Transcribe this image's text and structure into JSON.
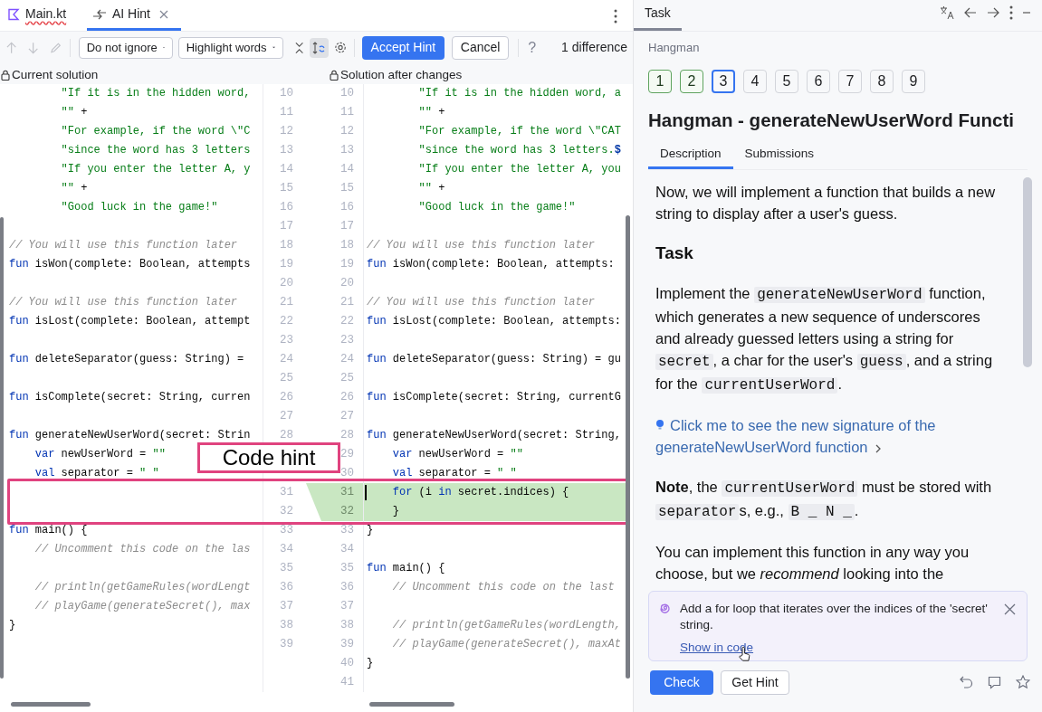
{
  "editor_tabs": [
    {
      "label": "Main.kt",
      "kind": "file",
      "selected": false,
      "has_error": true
    },
    {
      "label": "AI Hint",
      "kind": "diff",
      "selected": true,
      "closable": true
    }
  ],
  "toolbar": {
    "ignore_dropdown": "Do not ignore",
    "highlight_dropdown": "Highlight words",
    "sync_scroll_on": true,
    "accept_button": "Accept Hint",
    "cancel_button": "Cancel",
    "help": "?",
    "difference_count": "1 difference"
  },
  "diff": {
    "left_title": "Current solution",
    "right_title": "Solution after changes",
    "rows": [
      {
        "ln": "10",
        "l": [
          {
            "kind": "string",
            "text": "        \"If it is in the hidden word,"
          }
        ],
        "rn": "10",
        "r": [
          {
            "kind": "string",
            "text": "        \"If it is in the hidden word, a"
          }
        ],
        "changed": false
      },
      {
        "ln": "11",
        "l": [
          {
            "kind": "string",
            "text": "        \"\""
          },
          {
            "kind": "plain",
            "text": " +"
          }
        ],
        "rn": "11",
        "r": [
          {
            "kind": "string",
            "text": "        \"\""
          },
          {
            "kind": "plain",
            "text": " +"
          }
        ],
        "changed": false
      },
      {
        "ln": "12",
        "l": [
          {
            "kind": "string",
            "text": "        \"For example, if the word \\\"C"
          }
        ],
        "rn": "12",
        "r": [
          {
            "kind": "string",
            "text": "        \"For example, if the word \\\"CAT"
          }
        ],
        "changed": false
      },
      {
        "ln": "13",
        "l": [
          {
            "kind": "string",
            "text": "        \"since the word has 3 letters"
          }
        ],
        "rn": "13",
        "r": [
          {
            "kind": "string",
            "text": "        \"since the word has 3 letters."
          },
          {
            "kind": "template",
            "text": "$"
          }
        ],
        "changed": false
      },
      {
        "ln": "14",
        "l": [
          {
            "kind": "string",
            "text": "        \"If you enter the letter A, y"
          }
        ],
        "rn": "14",
        "r": [
          {
            "kind": "string",
            "text": "        \"If you enter the letter A, you"
          }
        ],
        "changed": false
      },
      {
        "ln": "15",
        "l": [
          {
            "kind": "string",
            "text": "        \"\""
          },
          {
            "kind": "plain",
            "text": " +"
          }
        ],
        "rn": "15",
        "r": [
          {
            "kind": "string",
            "text": "        \"\""
          },
          {
            "kind": "plain",
            "text": " +"
          }
        ],
        "changed": false
      },
      {
        "ln": "16",
        "l": [
          {
            "kind": "string",
            "text": "        \"Good luck in the game!\""
          }
        ],
        "rn": "16",
        "r": [
          {
            "kind": "string",
            "text": "        \"Good luck in the game!\""
          }
        ],
        "changed": false
      },
      {
        "ln": "17",
        "l": [],
        "rn": "17",
        "r": [],
        "changed": false
      },
      {
        "ln": "18",
        "l": [
          {
            "kind": "comment",
            "text": "// You will use this function later"
          }
        ],
        "rn": "18",
        "r": [
          {
            "kind": "comment",
            "text": "// You will use this function later"
          }
        ],
        "changed": false
      },
      {
        "ln": "19",
        "l": [
          {
            "kind": "keyword",
            "text": "fun"
          },
          {
            "kind": "plain",
            "text": " isWon(complete: Boolean, attempts"
          }
        ],
        "rn": "19",
        "r": [
          {
            "kind": "keyword",
            "text": "fun"
          },
          {
            "kind": "plain",
            "text": " isWon(complete: Boolean, attempts:"
          }
        ],
        "changed": false
      },
      {
        "ln": "20",
        "l": [],
        "rn": "20",
        "r": [],
        "changed": false
      },
      {
        "ln": "21",
        "l": [
          {
            "kind": "comment",
            "text": "// You will use this function later"
          }
        ],
        "rn": "21",
        "r": [
          {
            "kind": "comment",
            "text": "// You will use this function later"
          }
        ],
        "changed": false
      },
      {
        "ln": "22",
        "l": [
          {
            "kind": "keyword",
            "text": "fun"
          },
          {
            "kind": "plain",
            "text": " isLost(complete: Boolean, attempt"
          }
        ],
        "rn": "22",
        "r": [
          {
            "kind": "keyword",
            "text": "fun"
          },
          {
            "kind": "plain",
            "text": " isLost(complete: Boolean, attempts:"
          }
        ],
        "changed": false
      },
      {
        "ln": "23",
        "l": [],
        "rn": "23",
        "r": [],
        "changed": false
      },
      {
        "ln": "24",
        "l": [
          {
            "kind": "keyword",
            "text": "fun"
          },
          {
            "kind": "plain",
            "text": " deleteSeparator(guess: String) ="
          }
        ],
        "rn": "24",
        "r": [
          {
            "kind": "keyword",
            "text": "fun"
          },
          {
            "kind": "plain",
            "text": " deleteSeparator(guess: String) = gu"
          }
        ],
        "changed": false
      },
      {
        "ln": "25",
        "l": [],
        "rn": "25",
        "r": [],
        "changed": false
      },
      {
        "ln": "26",
        "l": [
          {
            "kind": "keyword",
            "text": "fun"
          },
          {
            "kind": "plain",
            "text": " isComplete(secret: String, curren"
          }
        ],
        "rn": "26",
        "r": [
          {
            "kind": "keyword",
            "text": "fun"
          },
          {
            "kind": "plain",
            "text": " isComplete(secret: String, currentG"
          }
        ],
        "changed": false
      },
      {
        "ln": "27",
        "l": [],
        "rn": "27",
        "r": [],
        "changed": false
      },
      {
        "ln": "28",
        "l": [
          {
            "kind": "keyword",
            "text": "fun"
          },
          {
            "kind": "plain",
            "text": " generateNewUserWord(secret: Strin"
          }
        ],
        "rn": "28",
        "r": [
          {
            "kind": "keyword",
            "text": "fun"
          },
          {
            "kind": "plain",
            "text": " generateNewUserWord(secret: String,"
          }
        ],
        "changed": false
      },
      {
        "l": [
          {
            "kind": "keyword",
            "text": "    var"
          },
          {
            "kind": "plain",
            "text": " newUserWord = "
          },
          {
            "kind": "string",
            "text": "\"\""
          }
        ],
        "rn": "29",
        "r": [
          {
            "kind": "keyword",
            "text": "    var"
          },
          {
            "kind": "plain",
            "text": " newUserWord = "
          },
          {
            "kind": "string",
            "text": "\"\""
          }
        ],
        "changed": false
      },
      {
        "l": [
          {
            "kind": "keyword",
            "text": "    val"
          },
          {
            "kind": "plain",
            "text": " separator = "
          },
          {
            "kind": "string",
            "text": "\" \""
          }
        ],
        "rn": "30",
        "r": [
          {
            "kind": "keyword",
            "text": "    val"
          },
          {
            "kind": "plain",
            "text": " separator = "
          },
          {
            "kind": "string",
            "text": "\" \""
          }
        ],
        "changed": false
      },
      {
        "ln": "31",
        "l": [],
        "rn": "31",
        "r": [
          {
            "kind": "keyword",
            "text": "    for"
          },
          {
            "kind": "plain",
            "text": " (i "
          },
          {
            "kind": "keyword",
            "text": "in"
          },
          {
            "kind": "plain",
            "text": " secret.indices) {"
          }
        ],
        "changed": true,
        "caret": true
      },
      {
        "ln": "32",
        "l": [],
        "rn": "32",
        "r": [
          {
            "kind": "plain",
            "text": "    }"
          }
        ],
        "changed": true
      },
      {
        "ln": "33",
        "l": [
          {
            "kind": "keyword",
            "text": "fun"
          },
          {
            "kind": "plain",
            "text": " main() {"
          }
        ],
        "rn": "33",
        "r": [
          {
            "kind": "plain",
            "text": "}"
          }
        ],
        "changed": false
      },
      {
        "ln": "34",
        "l": [
          {
            "kind": "comment",
            "text": "    // Uncomment this code on the las"
          }
        ],
        "rn": "34",
        "r": [],
        "changed": false
      },
      {
        "ln": "35",
        "l": [],
        "rn": "35",
        "r": [
          {
            "kind": "keyword",
            "text": "fun"
          },
          {
            "kind": "plain",
            "text": " main() {"
          }
        ],
        "changed": false
      },
      {
        "ln": "36",
        "l": [
          {
            "kind": "comment",
            "text": "    // println(getGameRules(wordLengt"
          }
        ],
        "rn": "36",
        "r": [
          {
            "kind": "comment",
            "text": "    // Uncomment this code on the last"
          }
        ],
        "changed": false
      },
      {
        "ln": "37",
        "l": [
          {
            "kind": "comment",
            "text": "    // playGame(generateSecret(), max"
          }
        ],
        "rn": "37",
        "r": [],
        "changed": false
      },
      {
        "ln": "38",
        "l": [
          {
            "kind": "plain",
            "text": "}"
          }
        ],
        "rn": "38",
        "r": [
          {
            "kind": "comment",
            "text": "    // println(getGameRules(wordLength,"
          }
        ],
        "changed": false
      },
      {
        "ln": "39",
        "l": [],
        "rn": "39",
        "r": [
          {
            "kind": "comment",
            "text": "    // playGame(generateSecret(), maxAt"
          }
        ],
        "changed": false
      },
      {
        "l": [],
        "rn": "40",
        "r": [
          {
            "kind": "plain",
            "text": "}"
          }
        ],
        "changed": false
      },
      {
        "l": [],
        "rn": "41",
        "r": [],
        "changed": false
      }
    ]
  },
  "annotation": {
    "label": "Code hint"
  },
  "task_panel": {
    "tab": "Task",
    "breadcrumb": "Hangman",
    "steps": [
      {
        "label": "1",
        "solved": true,
        "selected": false
      },
      {
        "label": "2",
        "solved": true,
        "selected": false
      },
      {
        "label": "3",
        "solved": false,
        "selected": true
      },
      {
        "label": "4",
        "solved": false,
        "selected": false
      },
      {
        "label": "5",
        "solved": false,
        "selected": false
      },
      {
        "label": "6",
        "solved": false,
        "selected": false
      },
      {
        "label": "7",
        "solved": false,
        "selected": false
      },
      {
        "label": "8",
        "solved": false,
        "selected": false
      },
      {
        "label": "9",
        "solved": false,
        "selected": false
      }
    ],
    "title": "Hangman - generateNewUserWord Functi",
    "tabs": [
      {
        "label": "Description",
        "selected": true
      },
      {
        "label": "Submissions",
        "selected": false
      }
    ],
    "description": [
      {
        "kind": "paragraph",
        "spans": [
          {
            "kind": "text",
            "text": "Now, we will implement a function that builds a new string to display after a user's guess."
          }
        ]
      },
      {
        "kind": "heading",
        "spans": [
          {
            "kind": "text",
            "text": "Task"
          }
        ]
      },
      {
        "kind": "paragraph",
        "spans": [
          {
            "kind": "text",
            "text": "Implement the "
          },
          {
            "kind": "code",
            "text": "generateNewUserWord"
          },
          {
            "kind": "text",
            "text": " function, which generates a new sequence of underscores and already guessed letters using a string for "
          },
          {
            "kind": "code",
            "text": "secret"
          },
          {
            "kind": "text",
            "text": ", a char for the user's "
          },
          {
            "kind": "code",
            "text": "guess"
          },
          {
            "kind": "text",
            "text": ", and a string for the "
          },
          {
            "kind": "code",
            "text": "currentUserWord"
          },
          {
            "kind": "text",
            "text": "."
          }
        ]
      },
      {
        "kind": "hint_link",
        "spans": [
          {
            "kind": "text",
            "text": "Click me to see the new signature of the generateNewUserWord function"
          }
        ]
      },
      {
        "kind": "paragraph",
        "spans": [
          {
            "kind": "bold",
            "text": "Note"
          },
          {
            "kind": "text",
            "text": ", the "
          },
          {
            "kind": "code",
            "text": "currentUserWord"
          },
          {
            "kind": "text",
            "text": " must be stored with "
          },
          {
            "kind": "code",
            "text": "separator"
          },
          {
            "kind": "text",
            "text": "s, e.g., "
          },
          {
            "kind": "code",
            "text": "B _ N _"
          },
          {
            "kind": "text",
            "text": "."
          }
        ]
      },
      {
        "kind": "paragraph",
        "spans": [
          {
            "kind": "text",
            "text": "You can implement this function in any way you choose, but we "
          },
          {
            "kind": "italic",
            "text": "recommend"
          },
          {
            "kind": "text",
            "text": " looking into the"
          }
        ]
      }
    ],
    "hint_card": {
      "text": "Add a for loop that iterates over the indices of the 'secret' string.",
      "link": "Show in code"
    },
    "check_button": "Check",
    "hint_button": "Get Hint"
  }
}
